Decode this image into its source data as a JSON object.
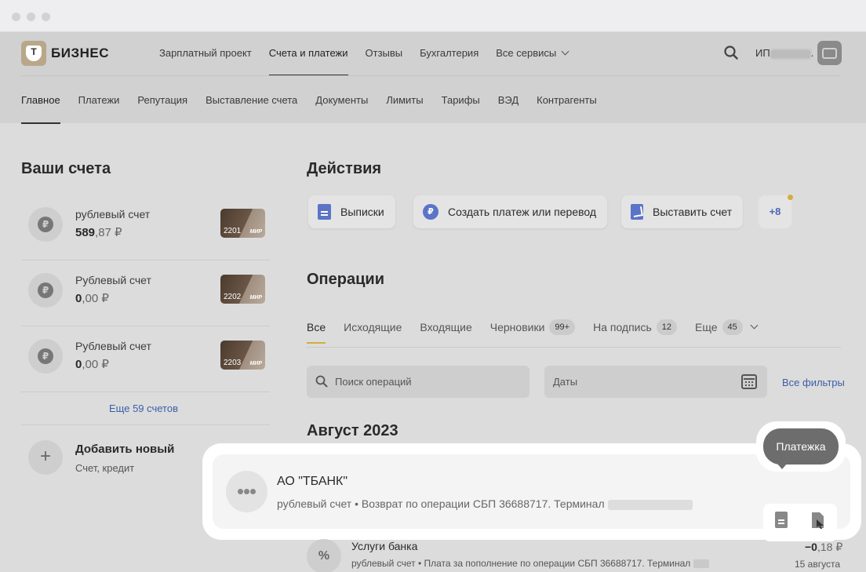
{
  "header": {
    "logo_text": "БИЗНЕС",
    "logo_letter": "Т",
    "nav": [
      "Зарплатный проект",
      "Счета и платежи",
      "Отзывы",
      "Бухгалтерия",
      "Все сервисы"
    ],
    "active_nav_index": 1,
    "user_prefix": "ИП",
    "user_suffix": "."
  },
  "subnav": {
    "items": [
      "Главное",
      "Платежи",
      "Репутация",
      "Выставление счета",
      "Документы",
      "Лимиты",
      "Тарифы",
      "ВЭД",
      "Контрагенты"
    ],
    "active_index": 0
  },
  "accounts": {
    "title": "Ваши счета",
    "items": [
      {
        "name": "рублевый счет",
        "balance_int": "589",
        "balance_dec": ",87 ₽",
        "card_num": "2201",
        "card_brand": "МИР"
      },
      {
        "name": "Рублевый счет",
        "balance_int": "0",
        "balance_dec": ",00 ₽",
        "card_num": "2202",
        "card_brand": "МИР"
      },
      {
        "name": "Рублевый счет",
        "balance_int": "0",
        "balance_dec": ",00 ₽",
        "card_num": "2203",
        "card_brand": "МИР"
      }
    ],
    "currency_symbol": "₽",
    "more_link": "Еще 59 счетов",
    "add_title": "Добавить новый",
    "add_sub": "Счет, кредит",
    "add_symbol": "+"
  },
  "actions": {
    "title": "Действия",
    "buttons": [
      {
        "label": "Выписки",
        "icon": "document-icon"
      },
      {
        "label": "Создать платеж или перевод",
        "icon": "ruble-icon"
      },
      {
        "label": "Выставить счет",
        "icon": "invoice-icon"
      }
    ],
    "more_label": "+8",
    "ruble_glyph": "₽"
  },
  "operations": {
    "title": "Операции",
    "tabs": [
      {
        "label": "Все",
        "badge": ""
      },
      {
        "label": "Исходящие",
        "badge": ""
      },
      {
        "label": "Входящие",
        "badge": ""
      },
      {
        "label": "Черновики",
        "badge": "99+"
      },
      {
        "label": "На подпись",
        "badge": "12"
      },
      {
        "label": "Еще",
        "badge": "45"
      }
    ],
    "active_tab_index": 0,
    "search_placeholder": "Поиск операций",
    "dates_placeholder": "Даты",
    "all_filters": "Все фильтры",
    "month_header": "Август 2023",
    "highlighted": {
      "title": "АО \"ТБАНК\"",
      "account": "рублевый счет",
      "separator": "•",
      "description": "Возврат по операции СБП 36688717. Терминал"
    },
    "tooltip": "Платежка",
    "bank_row": {
      "title": "Услуги банка",
      "account": "рублевый счет",
      "separator": "•",
      "description": "Плата за пополнение по операции СБП 36688717. Терминал",
      "amount_int": "−0",
      "amount_dec": ",18 ₽",
      "date": "15 августа",
      "icon_glyph": "%"
    }
  },
  "colors": {
    "accent_yellow": "#d4ad3a",
    "link_blue": "#3b5ea8",
    "icon_blue": "#5b74c8"
  }
}
